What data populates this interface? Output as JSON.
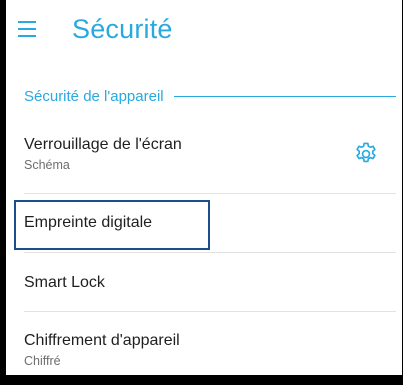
{
  "header": {
    "title": "Sécurité",
    "menu_icon": "hamburger-menu-icon"
  },
  "section": {
    "title": "Sécurité de l'appareil"
  },
  "items": [
    {
      "title": "Verrouillage de l'écran",
      "subtitle": "Schéma",
      "action_icon": "gear-icon"
    },
    {
      "title": "Empreinte digitale"
    },
    {
      "title": "Smart Lock"
    },
    {
      "title": "Chiffrement d'appareil",
      "subtitle": "Chiffré"
    }
  ],
  "colors": {
    "accent": "#29a9e0",
    "text": "#1f1f1f",
    "subtext": "#6e6e6e",
    "divider": "#e2e2e2",
    "highlight_border": "#1a4f8a"
  }
}
